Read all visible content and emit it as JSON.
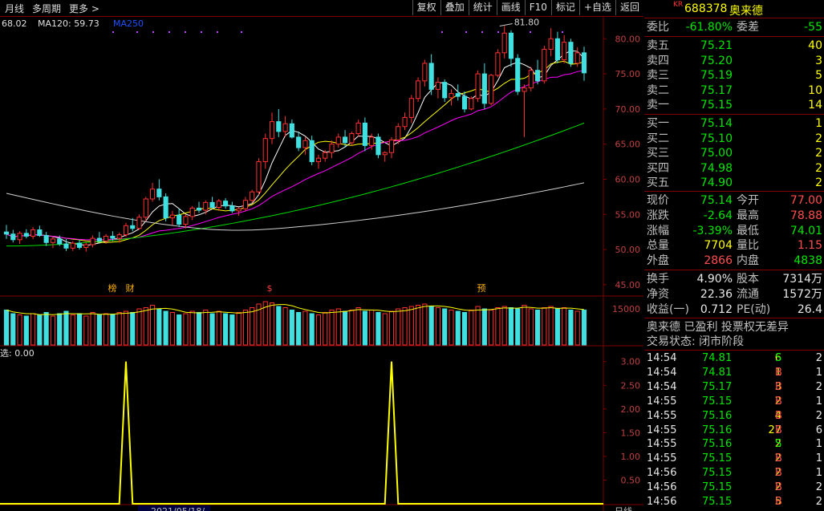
{
  "toolbar": {
    "left_items": [
      "月线",
      "多周期",
      "更多 >"
    ],
    "right_buttons": [
      "复权",
      "叠加",
      "统计",
      "画线",
      "F10",
      "标记",
      "+自选",
      "返回"
    ]
  },
  "ma_legend": [
    {
      "text": "68.02",
      "color": "#e0e0e0"
    },
    {
      "text": "MA120: 59.73",
      "color": "#e0e0e0"
    },
    {
      "text": "MA250",
      "color": "#2050ff"
    }
  ],
  "price_axis": [
    "80.00",
    "75.00",
    "70.00",
    "65.00",
    "60.00",
    "55.00",
    "50.00",
    "45.00"
  ],
  "volume_axis": [
    "15000"
  ],
  "indicator_axis": [
    "3.00",
    "2.50",
    "2.00",
    "1.50",
    "1.00",
    "0.50"
  ],
  "indicator_label": "选: 0.00",
  "high_label": "81.80",
  "event_markers": [
    {
      "text": "榜",
      "color": "#ffb000"
    },
    {
      "text": "财",
      "color": "#ffb000"
    },
    {
      "text": "$",
      "color": "#ff4040"
    },
    {
      "text": "预",
      "color": "#ffb000"
    }
  ],
  "bottom_date": "2021/05/18/",
  "bottom_right_label": "日线",
  "stock": {
    "kr": "KR",
    "code": "688378",
    "name": "奥来德"
  },
  "weibi": {
    "label": "委比",
    "value": "-61.80%",
    "label2": "委差",
    "value2": "-55"
  },
  "sell_orders": [
    {
      "label": "卖五",
      "price": "75.21",
      "vol": "40"
    },
    {
      "label": "卖四",
      "price": "75.20",
      "vol": "3"
    },
    {
      "label": "卖三",
      "price": "75.19",
      "vol": "5"
    },
    {
      "label": "卖二",
      "price": "75.17",
      "vol": "10"
    },
    {
      "label": "卖一",
      "price": "75.15",
      "vol": "14"
    }
  ],
  "buy_orders": [
    {
      "label": "买一",
      "price": "75.14",
      "vol": "1"
    },
    {
      "label": "买二",
      "price": "75.10",
      "vol": "2"
    },
    {
      "label": "买三",
      "price": "75.00",
      "vol": "2"
    },
    {
      "label": "买四",
      "price": "74.98",
      "vol": "2"
    },
    {
      "label": "买五",
      "price": "74.90",
      "vol": "2"
    }
  ],
  "quote": [
    {
      "l": "现价",
      "v": "75.14",
      "vc": "green",
      "l2": "今开",
      "v2": "77.00",
      "v2c": "red"
    },
    {
      "l": "涨跌",
      "v": "-2.64",
      "vc": "green",
      "l2": "最高",
      "v2": "78.88",
      "v2c": "red"
    },
    {
      "l": "涨幅",
      "v": "-3.39%",
      "vc": "green",
      "l2": "最低",
      "v2": "74.01",
      "v2c": "green"
    },
    {
      "l": "总量",
      "v": "7704",
      "vc": "yel",
      "l2": "量比",
      "v2": "1.15",
      "v2c": "red"
    },
    {
      "l": "外盘",
      "v": "2866",
      "vc": "red",
      "l2": "内盘",
      "v2": "4838",
      "v2c": "green"
    }
  ],
  "fund": [
    {
      "l": "换手",
      "v": "4.90%",
      "l2": "股本",
      "v2": "7314万"
    },
    {
      "l": "净资",
      "v": "22.36",
      "l2": "流通",
      "v2": "1572万"
    },
    {
      "l": "收益(一)",
      "v": "0.712",
      "l2": "PE(动)",
      "v2": "26.4"
    }
  ],
  "info_lines": [
    "奥来德 已盈利 投票权无差异",
    "交易状态: 闭市阶段"
  ],
  "ticks": [
    {
      "t": "14:54",
      "p": "74.81",
      "v": "6",
      "d": "S",
      "n": "2"
    },
    {
      "t": "14:54",
      "p": "74.81",
      "v": "1",
      "d": "B",
      "n": "1"
    },
    {
      "t": "14:54",
      "p": "75.17",
      "v": "3",
      "d": "B",
      "n": "2"
    },
    {
      "t": "14:55",
      "p": "75.15",
      "v": "2",
      "d": "B",
      "n": "1"
    },
    {
      "t": "14:55",
      "p": "75.16",
      "v": "4",
      "d": "B",
      "n": "2"
    },
    {
      "t": "14:55",
      "p": "75.16",
      "v": "27",
      "d": "B",
      "n": "6"
    },
    {
      "t": "14:55",
      "p": "75.16",
      "v": "2",
      "d": "S",
      "n": "1"
    },
    {
      "t": "14:55",
      "p": "75.15",
      "v": "2",
      "d": "B",
      "n": "1"
    },
    {
      "t": "14:56",
      "p": "75.15",
      "v": "2",
      "d": "B",
      "n": "1"
    },
    {
      "t": "14:56",
      "p": "75.15",
      "v": "2",
      "d": "B",
      "n": "2"
    },
    {
      "t": "14:56",
      "p": "75.15",
      "v": "5",
      "d": "B",
      "n": "2"
    }
  ],
  "chart_data": {
    "type": "candlestick",
    "ylim": [
      43.5,
      83
    ],
    "candles": [
      [
        52.5,
        53.5,
        51.5,
        52.2
      ],
      [
        52.2,
        52.8,
        51.0,
        51.4
      ],
      [
        51.4,
        52.6,
        50.8,
        52.3
      ],
      [
        52.3,
        52.9,
        51.6,
        51.9
      ],
      [
        51.9,
        53.2,
        51.5,
        52.8
      ],
      [
        52.8,
        53.4,
        51.8,
        52.0
      ],
      [
        52.0,
        52.5,
        50.5,
        51.0
      ],
      [
        51.0,
        51.8,
        50.2,
        51.5
      ],
      [
        51.5,
        52.0,
        50.5,
        50.8
      ],
      [
        50.8,
        51.5,
        49.8,
        50.2
      ],
      [
        50.2,
        51.2,
        49.8,
        50.9
      ],
      [
        50.9,
        51.4,
        50.0,
        50.3
      ],
      [
        50.3,
        51.0,
        49.7,
        50.7
      ],
      [
        50.7,
        52.0,
        50.3,
        51.6
      ],
      [
        51.6,
        52.5,
        50.9,
        51.2
      ],
      [
        51.2,
        52.2,
        50.8,
        51.9
      ],
      [
        51.9,
        52.6,
        51.2,
        51.6
      ],
      [
        51.6,
        52.4,
        51.0,
        52.1
      ],
      [
        52.1,
        53.8,
        51.8,
        53.4
      ],
      [
        53.4,
        54.5,
        52.6,
        53.0
      ],
      [
        53.0,
        55.0,
        52.8,
        54.6
      ],
      [
        54.6,
        57.5,
        54.0,
        57.2
      ],
      [
        57.2,
        59.5,
        56.8,
        58.6
      ],
      [
        58.6,
        60.0,
        57.0,
        57.5
      ],
      [
        57.5,
        58.0,
        54.0,
        54.5
      ],
      [
        54.5,
        55.5,
        53.5,
        54.9
      ],
      [
        54.9,
        55.8,
        53.2,
        53.6
      ],
      [
        53.6,
        55.0,
        53.0,
        54.7
      ],
      [
        54.7,
        56.2,
        54.2,
        55.9
      ],
      [
        55.9,
        56.8,
        55.2,
        55.6
      ],
      [
        55.6,
        57.0,
        55.0,
        56.7
      ],
      [
        56.7,
        57.5,
        55.8,
        56.0
      ],
      [
        56.0,
        57.2,
        55.5,
        56.9
      ],
      [
        56.9,
        57.3,
        55.8,
        56.2
      ],
      [
        56.2,
        56.8,
        55.2,
        55.5
      ],
      [
        55.5,
        56.0,
        54.8,
        55.8
      ],
      [
        55.8,
        57.5,
        55.5,
        57.0
      ],
      [
        57.0,
        58.5,
        56.6,
        58.2
      ],
      [
        58.2,
        63.0,
        57.8,
        62.5
      ],
      [
        62.5,
        66.5,
        61.5,
        65.8
      ],
      [
        65.8,
        69.5,
        65.0,
        68.2
      ],
      [
        68.2,
        70.0,
        66.0,
        66.8
      ],
      [
        66.8,
        69.0,
        66.0,
        67.9
      ],
      [
        67.9,
        68.5,
        65.8,
        66.0
      ],
      [
        66.0,
        66.8,
        64.0,
        64.5
      ],
      [
        64.5,
        66.0,
        63.5,
        65.5
      ],
      [
        65.5,
        66.2,
        62.0,
        62.5
      ],
      [
        62.5,
        63.5,
        61.5,
        63.0
      ],
      [
        63.0,
        64.2,
        62.5,
        63.8
      ],
      [
        63.8,
        65.5,
        63.0,
        65.0
      ],
      [
        65.0,
        66.5,
        64.5,
        66.0
      ],
      [
        66.0,
        67.0,
        64.5,
        65.2
      ],
      [
        65.2,
        66.8,
        64.8,
        66.5
      ],
      [
        66.5,
        68.5,
        66.0,
        68.0
      ],
      [
        68.0,
        68.8,
        64.0,
        64.8
      ],
      [
        64.8,
        66.5,
        64.2,
        66.0
      ],
      [
        66.0,
        66.5,
        63.0,
        63.5
      ],
      [
        63.5,
        64.0,
        62.5,
        63.8
      ],
      [
        63.8,
        66.0,
        63.0,
        65.6
      ],
      [
        65.6,
        68.0,
        65.0,
        67.5
      ],
      [
        67.5,
        69.5,
        67.0,
        68.8
      ],
      [
        68.8,
        72.0,
        68.0,
        71.5
      ],
      [
        71.5,
        74.5,
        71.0,
        74.0
      ],
      [
        74.0,
        77.0,
        73.2,
        76.5
      ],
      [
        76.5,
        77.8,
        72.0,
        72.8
      ],
      [
        72.8,
        74.5,
        71.5,
        73.8
      ],
      [
        73.8,
        74.2,
        71.0,
        71.6
      ],
      [
        71.6,
        72.8,
        70.5,
        72.2
      ],
      [
        72.2,
        73.5,
        71.2,
        71.8
      ],
      [
        71.8,
        72.5,
        69.5,
        70.0
      ],
      [
        70.0,
        71.8,
        69.8,
        71.5
      ],
      [
        71.5,
        75.5,
        71.0,
        75.0
      ],
      [
        75.0,
        76.5,
        70.0,
        70.8
      ],
      [
        70.8,
        75.0,
        70.5,
        74.8
      ],
      [
        74.8,
        78.5,
        74.5,
        78.0
      ],
      [
        78.0,
        81.8,
        77.2,
        80.8
      ],
      [
        80.8,
        81.2,
        76.0,
        77.2
      ],
      [
        77.2,
        77.8,
        72.0,
        72.5
      ],
      [
        72.5,
        73.5,
        66.0,
        73.0
      ],
      [
        73.0,
        76.0,
        72.5,
        75.5
      ],
      [
        75.5,
        77.0,
        73.5,
        74.0
      ],
      [
        74.0,
        79.0,
        73.6,
        78.5
      ],
      [
        78.5,
        81.5,
        77.5,
        80.0
      ],
      [
        80.0,
        81.0,
        76.5,
        77.0
      ],
      [
        77.0,
        80.5,
        76.5,
        79.5
      ],
      [
        79.5,
        80.0,
        76.0,
        76.5
      ],
      [
        76.5,
        78.8,
        76.0,
        78.0
      ],
      [
        78.0,
        78.88,
        74.01,
        75.14
      ]
    ],
    "volume_ylim": [
      0,
      20000
    ],
    "volumes": [
      14500,
      13000,
      12500,
      12000,
      13000,
      12500,
      13500,
      12000,
      13000,
      14000,
      12500,
      13000,
      12000,
      13500,
      12500,
      13000,
      12800,
      13500,
      14000,
      13500,
      15000,
      15500,
      16500,
      15000,
      14000,
      13500,
      12500,
      13000,
      14000,
      13500,
      14500,
      13000,
      14000,
      13000,
      12500,
      13500,
      14500,
      15500,
      17000,
      18000,
      17500,
      16000,
      15500,
      14500,
      13500,
      14000,
      13000,
      12500,
      13500,
      14500,
      15000,
      14000,
      14500,
      15500,
      14000,
      14500,
      13500,
      13000,
      14000,
      15000,
      15500,
      16000,
      16500,
      17000,
      16000,
      15500,
      15000,
      14500,
      14000,
      13500,
      14500,
      16000,
      15000,
      14500,
      15500,
      16000,
      15500,
      15000,
      16500,
      15000,
      14500,
      15500,
      16000,
      15000,
      15500,
      14500,
      14000,
      14500
    ],
    "indicator_ylim": [
      0,
      3.3
    ],
    "indicator_spikes": [
      18,
      58
    ]
  }
}
